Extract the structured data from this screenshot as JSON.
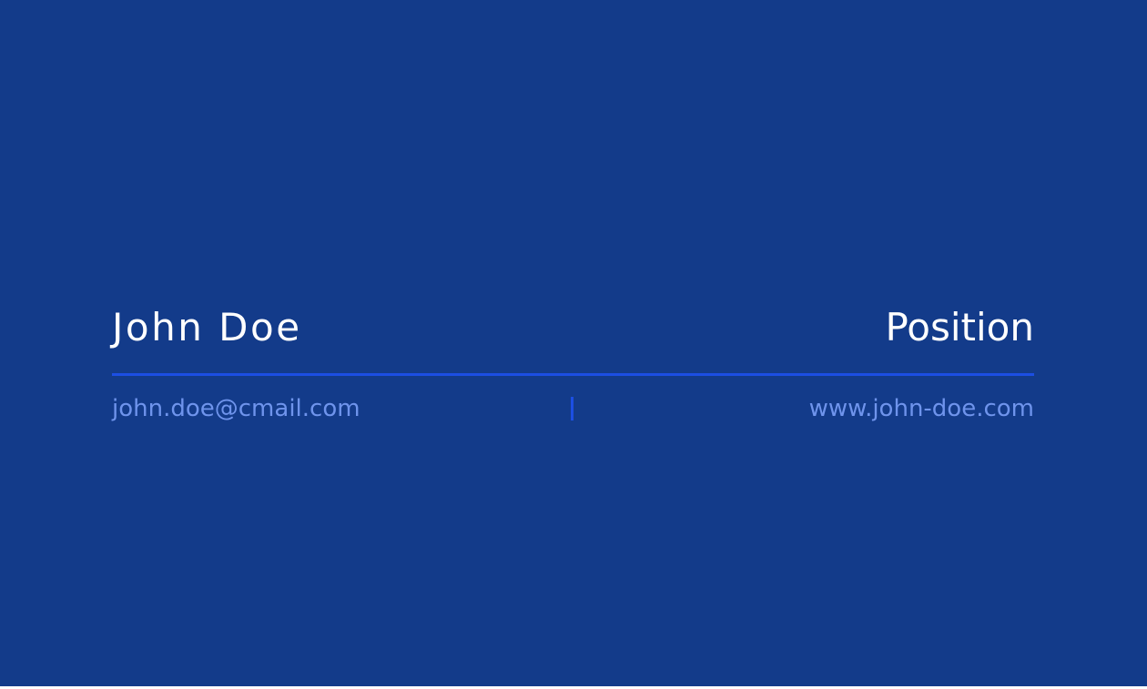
{
  "card": {
    "name": "John Doe",
    "position": "Position",
    "email": "john.doe@cmail.com",
    "website": "www.john-doe.com"
  },
  "colors": {
    "background": "#133b8a",
    "accent": "#1c4fe3",
    "primary_text": "#ffffff",
    "secondary_text": "#6f94ec"
  }
}
